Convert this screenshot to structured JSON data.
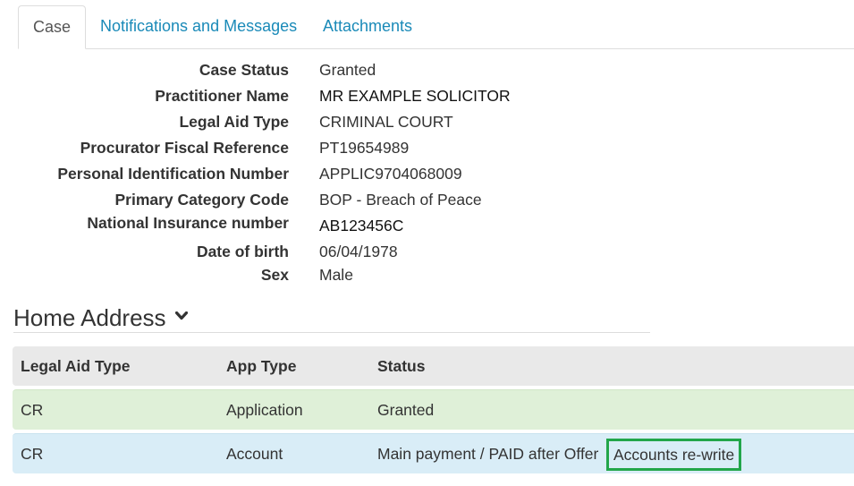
{
  "tabs": [
    {
      "label": "Case",
      "active": true
    },
    {
      "label": "Notifications and Messages",
      "active": false
    },
    {
      "label": "Attachments",
      "active": false
    }
  ],
  "details": [
    {
      "label": "Case Status",
      "value": "Granted"
    },
    {
      "label": "Practitioner Name",
      "value": "MR EXAMPLE SOLICITOR"
    },
    {
      "label": "Legal Aid Type",
      "value": "CRIMINAL COURT"
    },
    {
      "label": "Procurator Fiscal Reference",
      "value": "PT19654989"
    },
    {
      "label": "Personal Identification Number",
      "value": "APPLIC9704068009"
    },
    {
      "label": "Primary Category Code",
      "value": "BOP - Breach of Peace"
    },
    {
      "label": "National Insurance number",
      "value": "AB123456C"
    },
    {
      "label": "Date of birth",
      "value": "06/04/1978"
    },
    {
      "label": "Sex",
      "value": "Male"
    }
  ],
  "home_address": {
    "title": "Home Address",
    "icon": "chevron-down-icon"
  },
  "table": {
    "headers": [
      "Legal Aid Type",
      "App Type",
      "Status"
    ],
    "rows": [
      {
        "legal_aid_type": "CR",
        "app_type": "Application",
        "status": "Granted",
        "color": "#dff0d8"
      },
      {
        "legal_aid_type": "CR",
        "app_type": "Account",
        "status": "Main payment / PAID after Offer",
        "highlight": "Accounts re-write",
        "color": "#d9edf7"
      }
    ]
  },
  "colors": {
    "link": "#1a8ab8",
    "highlight_border": "#22a64a",
    "header_bg": "#e9e9e9"
  }
}
